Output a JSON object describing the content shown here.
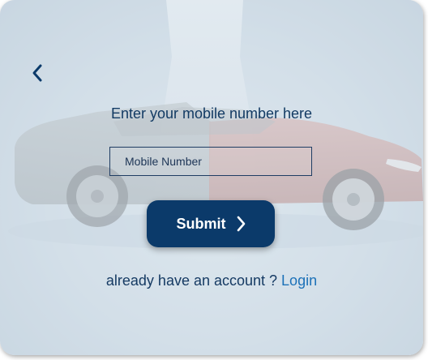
{
  "form": {
    "heading": "Enter your mobile number here",
    "mobile_placeholder": "Mobile Number",
    "mobile_value": ""
  },
  "actions": {
    "submit_label": "Submit"
  },
  "footer": {
    "prompt": "already have an account ? ",
    "login_label": "Login"
  },
  "icons": {
    "back": "chevron-left-icon",
    "submit_arrow": "chevron-right-icon"
  },
  "colors": {
    "primary": "#0b3a6a",
    "heading_text": "#123a63",
    "link": "#1c71b8"
  }
}
